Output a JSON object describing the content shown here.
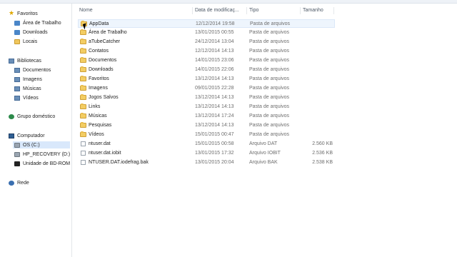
{
  "nav": {
    "favorites": "Favoritos",
    "fav_items": [
      "Área de Trabalho",
      "Downloads",
      "Locais"
    ],
    "libraries": "Bibliotecas",
    "lib_items": [
      "Documentos",
      "Imagens",
      "Músicas",
      "Vídeos"
    ],
    "homegroup": "Grupo doméstico",
    "computer": "Computador",
    "drives": [
      "OS (C:)",
      "HP_RECOVERY (D:)",
      "Unidade de BD-ROM"
    ],
    "network": "Rede"
  },
  "columns": {
    "name": "Nome",
    "date": "Data de modificaç...",
    "type": "Tipo",
    "size": "Tamanho"
  },
  "files": [
    {
      "name": "AppData",
      "date": "12/12/2014 19:58",
      "type": "Pasta de arquivos",
      "size": "",
      "icon": "folder-icon"
    },
    {
      "name": "Área de Trabalho",
      "date": "13/01/2015 00:55",
      "type": "Pasta de arquivos",
      "size": "",
      "icon": "folder-icon"
    },
    {
      "name": "aTubeCatcher",
      "date": "24/12/2014 13:04",
      "type": "Pasta de arquivos",
      "size": "",
      "icon": "folder-icon"
    },
    {
      "name": "Contatos",
      "date": "12/12/2014 14:13",
      "type": "Pasta de arquivos",
      "size": "",
      "icon": "folder-icon"
    },
    {
      "name": "Documentos",
      "date": "14/01/2015 23:06",
      "type": "Pasta de arquivos",
      "size": "",
      "icon": "folder-icon"
    },
    {
      "name": "Downloads",
      "date": "14/01/2015 22:06",
      "type": "Pasta de arquivos",
      "size": "",
      "icon": "folder-icon"
    },
    {
      "name": "Favoritos",
      "date": "13/12/2014 14:13",
      "type": "Pasta de arquivos",
      "size": "",
      "icon": "folder-icon"
    },
    {
      "name": "Imagens",
      "date": "09/01/2015 22:28",
      "type": "Pasta de arquivos",
      "size": "",
      "icon": "folder-icon"
    },
    {
      "name": "Jogos Salvos",
      "date": "13/12/2014 14:13",
      "type": "Pasta de arquivos",
      "size": "",
      "icon": "folder-icon"
    },
    {
      "name": "Links",
      "date": "13/12/2014 14:13",
      "type": "Pasta de arquivos",
      "size": "",
      "icon": "folder-icon"
    },
    {
      "name": "Músicas",
      "date": "13/12/2014 17:24",
      "type": "Pasta de arquivos",
      "size": "",
      "icon": "folder-icon"
    },
    {
      "name": "Pesquisas",
      "date": "13/12/2014 14:13",
      "type": "Pasta de arquivos",
      "size": "",
      "icon": "folder-icon"
    },
    {
      "name": "Vídeos",
      "date": "15/01/2015 00:47",
      "type": "Pasta de arquivos",
      "size": "",
      "icon": "folder-icon"
    },
    {
      "name": "ntuser.dat",
      "date": "15/01/2015 00:58",
      "type": "Arquivo DAT",
      "size": "2.560 KB",
      "icon": "file-icon"
    },
    {
      "name": "ntuser.dat.iobit",
      "date": "13/01/2015 17:32",
      "type": "Arquivo IOBIT",
      "size": "2.536 KB",
      "icon": "file-icon"
    },
    {
      "name": "NTUSER.DAT.iodefrag.bak",
      "date": "13/01/2015 20:04",
      "type": "Arquivo BAK",
      "size": "2.538 KB",
      "icon": "file-icon"
    }
  ]
}
